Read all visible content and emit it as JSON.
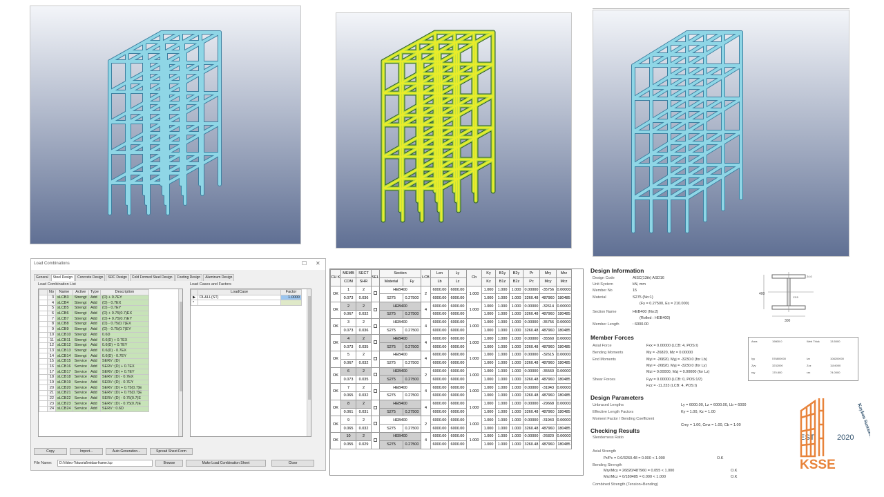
{
  "colors": {
    "sky_top": "#f3f5f9",
    "sky_bottom": "#5f6f93",
    "frame": "#8fd6e6",
    "frame_dark": "#3c7fa0",
    "result_green": "#a7d84a",
    "result_yellow": "#e8ec2a",
    "grid_selected": "#c7e3b8",
    "logo_orange": "#e8833a",
    "logo_dark": "#2d4e6a"
  },
  "load_combinations": {
    "title": "Load Combinations",
    "tabs": [
      "General",
      "Steel Design",
      "Concrete Design",
      "SRC Design",
      "Cold Formed Steel Design",
      "Footing Design",
      "Aluminum Design"
    ],
    "active_tab": "Steel Design",
    "list_title": "Load Combination List",
    "cases_title": "Load Cases and Factors",
    "columns": [
      "No",
      "Name",
      "Active",
      "Type",
      "Description"
    ],
    "rows": [
      [
        "3",
        "sLCB3",
        "Strengt",
        "Add",
        "(D) + 0.7EY"
      ],
      [
        "4",
        "sLCB4",
        "Strengt",
        "Add",
        "(D) - 0.7EX"
      ],
      [
        "5",
        "sLCB5",
        "Strengt",
        "Add",
        "(D) - 0.7EY"
      ],
      [
        "6",
        "sLCB6",
        "Strengt",
        "Add",
        "(D) + 0.75(0.7)EX"
      ],
      [
        "7",
        "sLCB7",
        "Strengt",
        "Add",
        "(D) + 0.75(0.7)EY"
      ],
      [
        "8",
        "sLCB8",
        "Strengt",
        "Add",
        "(D) - 0.75(0.7)EX"
      ],
      [
        "9",
        "sLCB9",
        "Strengt",
        "Add",
        "(D) - 0.75(0.7)EY"
      ],
      [
        "10",
        "sLCB10",
        "Strengt",
        "Add",
        "0.6D"
      ],
      [
        "11",
        "sLCB11",
        "Strengt",
        "Add",
        "0.6(D) + 0.7EX"
      ],
      [
        "12",
        "sLCB12",
        "Strengt",
        "Add",
        "0.6(D) + 0.7EY"
      ],
      [
        "13",
        "sLCB13",
        "Strengt",
        "Add",
        "0.6(D) - 0.7EX"
      ],
      [
        "14",
        "sLCB14",
        "Strengt",
        "Add",
        "0.6(D) - 0.7EY"
      ],
      [
        "15",
        "sLCB15",
        "Service",
        "Add",
        "SERV :(D)"
      ],
      [
        "16",
        "sLCB16",
        "Service",
        "Add",
        "SERV :(D) + 0.7EX"
      ],
      [
        "17",
        "sLCB17",
        "Service",
        "Add",
        "SERV :(D) + 0.7EY"
      ],
      [
        "18",
        "sLCB18",
        "Service",
        "Add",
        "SERV :(D) - 0.7EX"
      ],
      [
        "19",
        "sLCB19",
        "Service",
        "Add",
        "SERV :(D) - 0.7EY"
      ],
      [
        "20",
        "sLCB20",
        "Service",
        "Add",
        "SERV :(D) + 0.75(0.7)E"
      ],
      [
        "21",
        "sLCB21",
        "Service",
        "Add",
        "SERV :(D) + 0.75(0.7)E"
      ],
      [
        "22",
        "sLCB22",
        "Service",
        "Add",
        "SERV :(D) - 0.75(0.7)E"
      ],
      [
        "23",
        "sLCB23",
        "Service",
        "Add",
        "SERV :(D) - 0.75(0.7)E"
      ],
      [
        "24",
        "sLCB24",
        "Service",
        "Add",
        "SERV : 0.6D"
      ]
    ],
    "case_columns": [
      "LoadCase",
      "Factor"
    ],
    "case_rows": [
      [
        "DL&LL(ST)",
        "1.0000"
      ]
    ],
    "buttons": {
      "copy": "Copy",
      "import": "Import...",
      "auto": "Auto Generation...",
      "spreadsheet": "Spread Sheet Form",
      "browse": "Browse",
      "make_sheet": "Make Load Combination Sheet",
      "close": "Close"
    },
    "file_label": "File Name:",
    "file_value": "D:\\Video-Totuorial\\midas-frame.lcp"
  },
  "steel_table": {
    "header_top": [
      "CH K",
      "MEMB",
      "SECT",
      "SEL",
      "Section",
      "LCB",
      "Len",
      "Ly",
      "Cb",
      "Ky",
      "B1y",
      "B2y",
      "Pr",
      "Mry",
      "Mrz"
    ],
    "header_bottom": [
      "COM",
      "SHR",
      "Material",
      "Fy",
      "Lb",
      "Lz",
      "Kz",
      "B1z",
      "B2z",
      "Pc",
      "Mcy",
      "Mcz"
    ],
    "rows": [
      {
        "chk": "OK",
        "memb": "1",
        "sect": "2",
        "com": "0.073",
        "shr": "0.036",
        "section": "HEB400",
        "material": "S275",
        "fy": "0.27500",
        "lcb": "2",
        "len": "6000.00",
        "ly": "6000.00",
        "lb": "6000.00",
        "lz": "6000.00",
        "cb": "1.000",
        "ky": "1.000",
        "kz": "1.000",
        "b1y": "1.000",
        "b1z": "1.000",
        "b2y": "1.000",
        "b2z": "1.000",
        "pr": "0.00000",
        "pc": "3260.48",
        "mry": "-35756",
        "mcy": "487960",
        "mrz": "0.00000",
        "mcz": "180485"
      },
      {
        "chk": "OK",
        "memb": "2",
        "sect": "2",
        "com": "0.067",
        "shr": "0.032",
        "section": "HEB400",
        "material": "S275",
        "fy": "0.27500",
        "lcb": "4",
        "len": "6000.00",
        "ly": "6000.00",
        "lb": "6000.00",
        "lz": "6000.00",
        "cb": "1.000",
        "ky": "1.000",
        "kz": "1.000",
        "b1y": "1.000",
        "b1z": "1.000",
        "b2y": "1.000",
        "b2z": "1.000",
        "pr": "0.00000",
        "pc": "3260.48",
        "mry": "-32614",
        "mcy": "487960",
        "mrz": "0.00000",
        "mcz": "180485"
      },
      {
        "chk": "OK",
        "memb": "3",
        "sect": "2",
        "com": "0.073",
        "shr": "0.036",
        "section": "HEB400",
        "material": "S275",
        "fy": "0.27500",
        "lcb": "4",
        "len": "6000.00",
        "ly": "6000.00",
        "lb": "6000.00",
        "lz": "6000.00",
        "cb": "1.000",
        "ky": "1.000",
        "kz": "1.000",
        "b1y": "1.000",
        "b1z": "1.000",
        "b2y": "1.000",
        "b2z": "1.000",
        "pr": "0.00000",
        "pc": "3260.48",
        "mry": "-35756",
        "mcy": "487960",
        "mrz": "0.00000",
        "mcz": "180485"
      },
      {
        "chk": "OK",
        "memb": "4",
        "sect": "2",
        "com": "0.073",
        "shr": "0.035",
        "section": "HEB400",
        "material": "S275",
        "fy": "0.27500",
        "lcb": "4",
        "len": "6000.00",
        "ly": "6000.00",
        "lb": "6000.00",
        "lz": "6000.00",
        "cb": "1.000",
        "ky": "1.000",
        "kz": "1.000",
        "b1y": "1.000",
        "b1z": "1.000",
        "b2y": "1.000",
        "b2z": "1.000",
        "pr": "0.00000",
        "pc": "3260.48",
        "mry": "-35560",
        "mcy": "487960",
        "mrz": "0.00000",
        "mcz": "180485"
      },
      {
        "chk": "OK",
        "memb": "5",
        "sect": "2",
        "com": "0.067",
        "shr": "0.032",
        "section": "HEB400",
        "material": "S275",
        "fy": "0.27500",
        "lcb": "4",
        "len": "6000.00",
        "ly": "6000.00",
        "lb": "6000.00",
        "lz": "6000.00",
        "cb": "1.000",
        "ky": "1.000",
        "kz": "1.000",
        "b1y": "1.000",
        "b1z": "1.000",
        "b2y": "1.000",
        "b2z": "1.000",
        "pr": "0.00000",
        "pc": "3260.48",
        "mry": "-32615",
        "mcy": "487960",
        "mrz": "0.00000",
        "mcz": "180485"
      },
      {
        "chk": "OK",
        "memb": "6",
        "sect": "2",
        "com": "0.073",
        "shr": "0.035",
        "section": "HEB400",
        "material": "S275",
        "fy": "0.27500",
        "lcb": "2",
        "len": "6000.00",
        "ly": "6000.00",
        "lb": "6000.00",
        "lz": "6000.00",
        "cb": "1.000",
        "ky": "1.000",
        "kz": "1.000",
        "b1y": "1.000",
        "b1z": "1.000",
        "b2y": "1.000",
        "b2z": "1.000",
        "pr": "0.00000",
        "pc": "3260.48",
        "mry": "-35560",
        "mcy": "487960",
        "mrz": "0.00000",
        "mcz": "180485"
      },
      {
        "chk": "OK",
        "memb": "7",
        "sect": "2",
        "com": "0.065",
        "shr": "0.032",
        "section": "HEB400",
        "material": "S275",
        "fy": "0.27500",
        "lcb": "4",
        "len": "6000.00",
        "ly": "6000.00",
        "lb": "6000.00",
        "lz": "6000.00",
        "cb": "1.000",
        "ky": "1.000",
        "kz": "1.000",
        "b1y": "1.000",
        "b1z": "1.000",
        "b2y": "1.000",
        "b2z": "1.000",
        "pr": "0.00000",
        "pc": "3260.48",
        "mry": "-31943",
        "mcy": "487960",
        "mrz": "0.00000",
        "mcz": "180485"
      },
      {
        "chk": "OK",
        "memb": "8",
        "sect": "2",
        "com": "0.061",
        "shr": "0.031",
        "section": "HEB400",
        "material": "S275",
        "fy": "0.27500",
        "lcb": "4",
        "len": "6000.00",
        "ly": "6000.00",
        "lb": "6000.00",
        "lz": "6000.00",
        "cb": "1.000",
        "ky": "1.000",
        "kz": "1.000",
        "b1y": "1.000",
        "b1z": "1.000",
        "b2y": "1.000",
        "b2z": "1.000",
        "pr": "0.00000",
        "pc": "3260.48",
        "mry": "-29668",
        "mcy": "487960",
        "mrz": "0.00000",
        "mcz": "180485"
      },
      {
        "chk": "OK",
        "memb": "9",
        "sect": "2",
        "com": "0.065",
        "shr": "0.032",
        "section": "HEB400",
        "material": "S275",
        "fy": "0.27500",
        "lcb": "2",
        "len": "6000.00",
        "ly": "6000.00",
        "lb": "6000.00",
        "lz": "6000.00",
        "cb": "1.000",
        "ky": "1.000",
        "kz": "1.000",
        "b1y": "1.000",
        "b1z": "1.000",
        "b2y": "1.000",
        "b2z": "1.000",
        "pr": "0.00000",
        "pc": "3260.48",
        "mry": "-31943",
        "mcy": "487960",
        "mrz": "0.00000",
        "mcz": "180485"
      },
      {
        "chk": "OK",
        "memb": "10",
        "sect": "2",
        "com": "0.055",
        "shr": "0.029",
        "section": "HEB400",
        "material": "S275",
        "fy": "0.27500",
        "lcb": "4",
        "len": "6000.00",
        "ly": "6000.00",
        "lb": "6000.00",
        "lz": "6000.00",
        "cb": "1.000",
        "ky": "1.000",
        "kz": "1.000",
        "b1y": "1.000",
        "b1z": "1.000",
        "b2y": "1.000",
        "b2z": "1.000",
        "pr": "0.00000",
        "pc": "3260.48",
        "mry": "-26820",
        "mcy": "487960",
        "mrz": "0.00000",
        "mcz": "180485"
      }
    ]
  },
  "report": {
    "design_info": "Design Information",
    "member_forces": "Member Forces",
    "design_params": "Design Parameters",
    "checking": "Checking Results",
    "lines": {
      "design_code_k": "Design Code",
      "design_code_v": "AISC(13th) ASD16",
      "unit_k": "Unit System",
      "unit_v": "kN, mm",
      "member_k": "Member No",
      "member_v": "15",
      "material_k": "Material",
      "material_v": "S275 (No:1)",
      "material_v2": "(Fy = 0.27500, Es = 210.000)",
      "section_k": "Section Name",
      "section_v": "HEB400 (No:2)",
      "section_v2": "(Rolled : HEB400)",
      "length_k": "Member Length",
      "length_v": ": 6000.00",
      "axial_k": "Axial Force",
      "axial_v": "Fxx = 0.00000 (LCB: 4, POS:I)",
      "bend_k": "Bending Moments",
      "bend_v": "My = -26820, Mz = 0.00000",
      "end_k": "End Moments",
      "end_v1": "Myi = -26820, Myj = -3230.0 (for Lb)",
      "end_v2": "Myi = -26820, Myj = -3230.0 (for Ly)",
      "end_v3": "Mzi = 0.00000, Mzj = 0.00000 (for Lz)",
      "shear_k": "Shear Forces",
      "shear_v1": "Fyy = 0.00000 (LCB: 0, POS:1/2)",
      "shear_v2": "Fzz = -11.233 (LCB: 4, POS:I)",
      "unbr_k": "Unbraced Lengths",
      "unbr_v": "Ly = 6000.00,  Lz = 6000.00,  Lb = 6000",
      "eff_k": "Effective Length Factors",
      "eff_v": "Ky = 1.00,  Kz = 1.00",
      "mom_k": "Moment Factor / Bending Coefficient",
      "mom_v": "Cmy = 1.00,  Cmz = 1.00,  Cb = 1.00",
      "slender_k": "Slenderness Ratio",
      "axial_str_k": "Axial Strength",
      "pr_v": "Pr/Pc  =  0.0/3260.48 = 0.000 < 1.000",
      "bend_str_k": "Bending Strength",
      "mry_v": "Mry/Mcy  =  26820/487960 = 0.055 < 1.000",
      "mrz_v": "Mrz/Mcz  =  0/180485 = 0.000 < 1.000",
      "ok1": "O.K",
      "ok2": "O.K",
      "ok3": "O.K",
      "combined_k": "Combined Strength (Tension+Bending)"
    },
    "props": {
      "area_k": "Area",
      "area_v": "19800.0",
      "web_k": "Web Thick",
      "web_v": "13.5000",
      "iyy_k": "Iyy",
      "iyy_v": "576800000",
      "izz_k": "Izz",
      "izz_v": "108200000",
      "zyy_k": "Zyy",
      "zyy_v": "3232000",
      "zzz_k": "Zzz",
      "zzz_v": "1104000",
      "ryy_k": "ryy",
      "ryy_v": "170.800",
      "rzz_k": "rzz",
      "rzz_v": "74.0000"
    },
    "section_dims": {
      "h": "400",
      "b": "300",
      "tw": "13.5",
      "tf": "24.0"
    }
  },
  "logo": {
    "est": "EST.",
    "year": "2020",
    "mark": "KSSE",
    "ring": "Kayhan Sustained Structural Engineering"
  }
}
